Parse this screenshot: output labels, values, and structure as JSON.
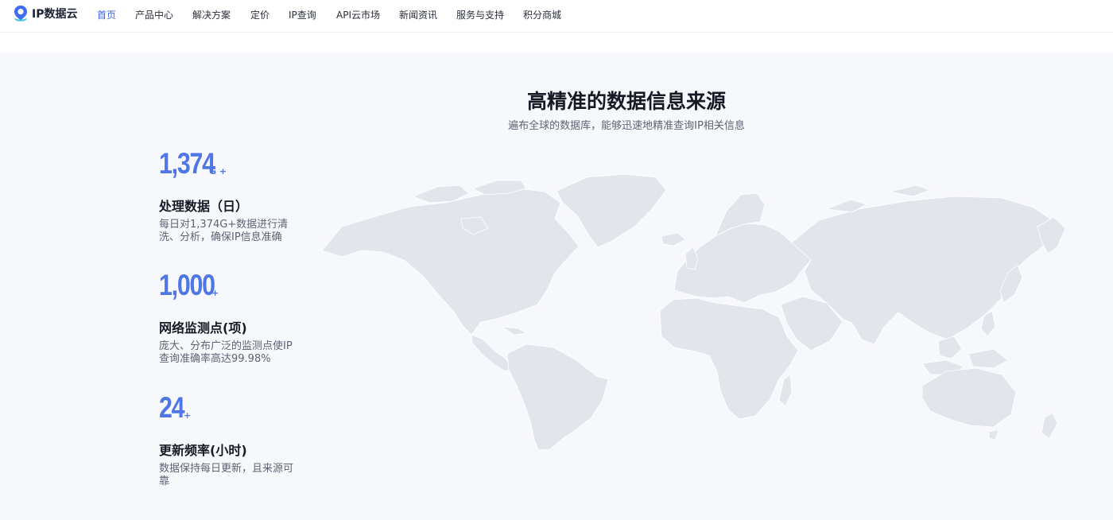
{
  "brand": {
    "name": "IP数据云",
    "logo": "location-pin-logo"
  },
  "nav": {
    "items": [
      {
        "label": "首页",
        "active": true
      },
      {
        "label": "产品中心",
        "active": false
      },
      {
        "label": "解决方案",
        "active": false
      },
      {
        "label": "定价",
        "active": false
      },
      {
        "label": "IP查询",
        "active": false
      },
      {
        "label": "API云市场",
        "active": false
      },
      {
        "label": "新闻资讯",
        "active": false
      },
      {
        "label": "服务与支持",
        "active": false
      },
      {
        "label": "积分商城",
        "active": false
      }
    ]
  },
  "section": {
    "title": "高精准的数据信息来源",
    "subtitle": "遍布全球的数据库，能够迅速地精准查询IP相关信息"
  },
  "stats": [
    {
      "value": "1,374",
      "unit": "G +",
      "label": "处理数据（日）",
      "desc": "每日对1,374G+数据进行清洗、分析，确保IP信息准确"
    },
    {
      "value": "1,000",
      "unit": "+",
      "label": "网络监测点(项)",
      "desc": "庞大、分布广泛的监测点使IP查询准确率高达99.98%"
    },
    {
      "value": "24",
      "unit": "+",
      "label": "更新频率(小时)",
      "desc": "数据保持每日更新，且来源可靠"
    }
  ],
  "map": {
    "icon": "world-map-illustration"
  },
  "colors": {
    "accent": "#4f76e6",
    "nav_active": "#3a63e6",
    "band_bg": "#f6f8fc",
    "map_land": "#e2e5ec",
    "title": "#161a24",
    "muted": "#5d6372"
  }
}
